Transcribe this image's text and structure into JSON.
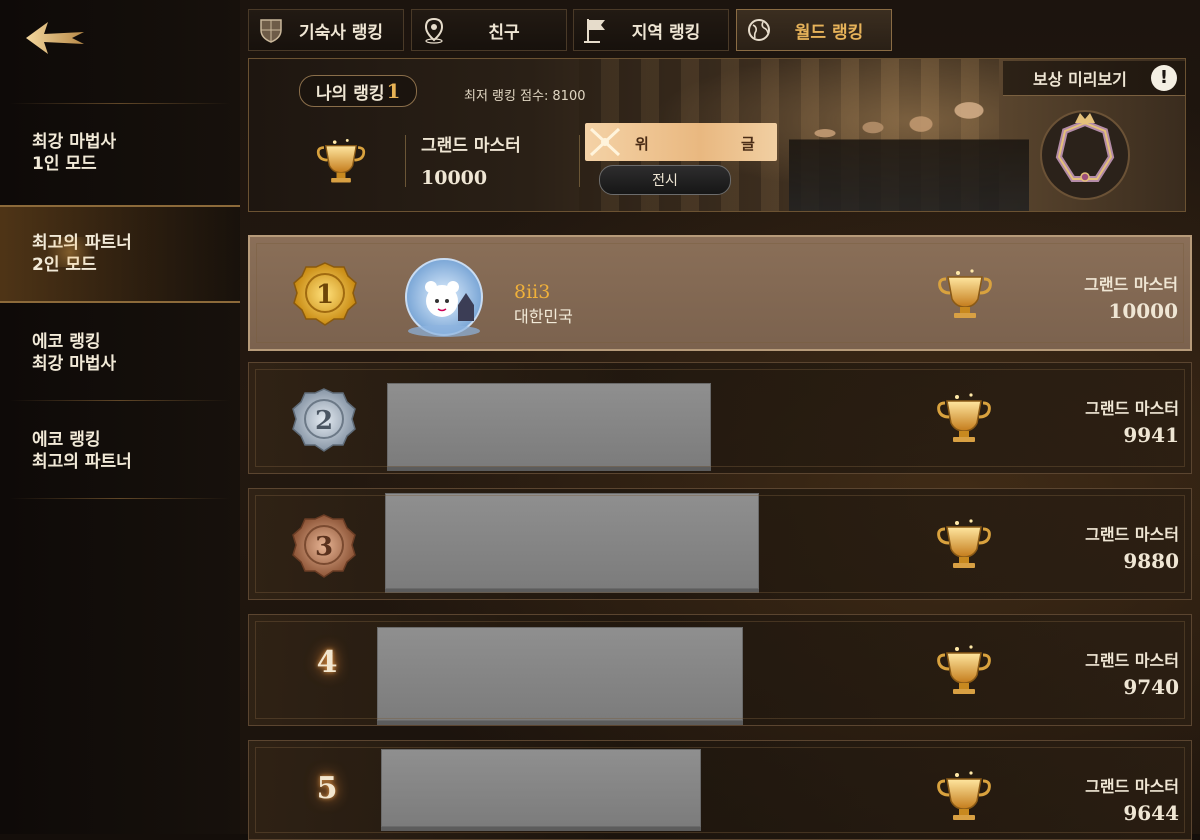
{
  "sidebar": {
    "items": [
      {
        "label": "최강 마법사\n1인 모드",
        "active": false
      },
      {
        "label": "최고의 파트너\n2인 모드",
        "active": true
      },
      {
        "label": "에코 랭킹\n최강 마법사",
        "active": false
      },
      {
        "label": "에코 랭킹\n최고의 파트너",
        "active": false
      }
    ]
  },
  "tabs": [
    {
      "label": "기숙사 랭킹",
      "icon": "crest-icon"
    },
    {
      "label": "친구",
      "icon": "location-pin-icon"
    },
    {
      "label": "지역 랭킹",
      "icon": "flag-icon"
    },
    {
      "label": "월드 랭킹",
      "icon": "globe-icon",
      "active": true
    }
  ],
  "my_rank": {
    "label": "나의 랭킹",
    "rank": "1",
    "min_score_label": "최저 랭킹 점수:",
    "min_score_value": "8100",
    "tier": "그랜드 마스터",
    "score": "10000",
    "title_text_left": "위",
    "title_text_right": "글",
    "show_button": "전시",
    "reward_preview_label": "보상 미리보기",
    "alert_symbol": "!"
  },
  "rankings": [
    {
      "rank": "1",
      "name": "8ii3",
      "country": "대한민국",
      "tier": "그랜드 마스터",
      "score": "10000",
      "medal": "gold"
    },
    {
      "rank": "2",
      "tier": "그랜드 마스터",
      "score": "9941",
      "medal": "silver",
      "redacted": true
    },
    {
      "rank": "3",
      "tier": "그랜드 마스터",
      "score": "9880",
      "medal": "bronze",
      "redacted": true
    },
    {
      "rank": "4",
      "tier": "그랜드 마스터",
      "score": "9740",
      "redacted": true
    },
    {
      "rank": "5",
      "tier": "그랜드 마스터",
      "score": "9644",
      "redacted": true
    }
  ],
  "colors": {
    "accent_gold": "#e8b355",
    "name_gold": "#f0b13a"
  }
}
